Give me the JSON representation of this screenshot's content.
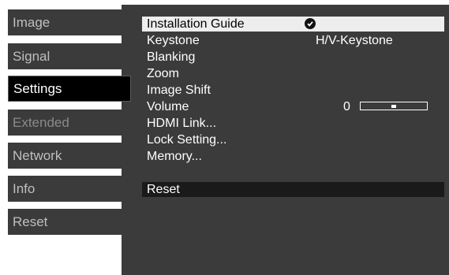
{
  "tabs": [
    {
      "label": "Image",
      "state": "normal"
    },
    {
      "label": "Signal",
      "state": "normal"
    },
    {
      "label": "Settings",
      "state": "active"
    },
    {
      "label": "Extended",
      "state": "dim"
    },
    {
      "label": "Network",
      "state": "normal"
    },
    {
      "label": "Info",
      "state": "normal"
    },
    {
      "label": "Reset",
      "state": "normal"
    }
  ],
  "menu": {
    "items": [
      {
        "label": "Installation Guide",
        "value": "",
        "icon": "check-circle-icon"
      },
      {
        "label": "Keystone",
        "value": "H/V-Keystone"
      },
      {
        "label": "Blanking",
        "value": ""
      },
      {
        "label": "Zoom",
        "value": ""
      },
      {
        "label": "Image Shift",
        "value": ""
      },
      {
        "label": "Volume",
        "value": "0",
        "level_percent": 50
      },
      {
        "label": "HDMI Link...",
        "value": ""
      },
      {
        "label": "Lock Setting...",
        "value": ""
      },
      {
        "label": "Memory...",
        "value": ""
      }
    ],
    "reset_label": "Reset"
  },
  "colors": {
    "panel": "#3b3b3b",
    "active_tab": "#000000",
    "selected_row": "#ededed",
    "text": "#ffffff",
    "dim_text": "#8a8a8a"
  }
}
